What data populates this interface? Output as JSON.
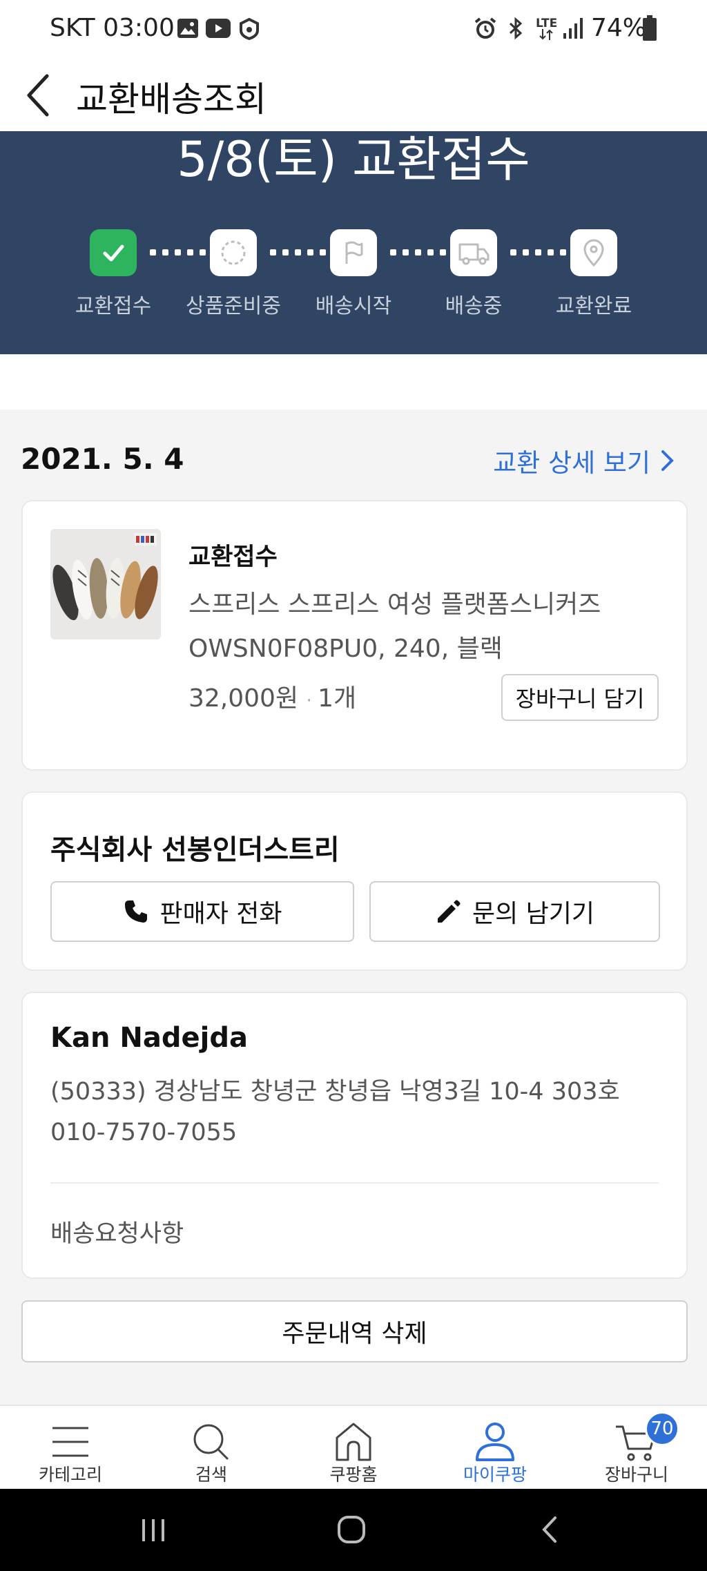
{
  "status_bar": {
    "carrier_time": "SKT 03:00",
    "battery": "74%",
    "lte": "LTE"
  },
  "header": {
    "title": "교환배송조회"
  },
  "hero": {
    "title": "5/8(토) 교환접수",
    "steps": [
      {
        "label": "교환접수",
        "icon": "check-icon",
        "done": true
      },
      {
        "label": "상품준비중",
        "icon": "loading-circle-icon",
        "done": false
      },
      {
        "label": "배송시작",
        "icon": "flag-icon",
        "done": false
      },
      {
        "label": "배송중",
        "icon": "truck-icon",
        "done": false
      },
      {
        "label": "교환완료",
        "icon": "location-pin-icon",
        "done": false
      }
    ]
  },
  "order": {
    "date": "2021. 5. 4",
    "detail_link": "교환 상세 보기",
    "status": "교환접수",
    "product_name": "스프리스 스프리스 여성 플랫폼스니커즈",
    "product_option": "OWSN0F08PU0, 240, 블랙",
    "price": "32,000원",
    "quantity": "1개",
    "cart_button": "장바구니 담기"
  },
  "seller": {
    "name": "주식회사 선봉인더스트리",
    "call_button": "판매자 전화",
    "inquiry_button": "문의 남기기"
  },
  "shipping": {
    "recipient": "Kan Nadejda",
    "address": "(50333) 경상남도 창녕군 창녕읍 낙영3길 10-4 303호",
    "phone": "010-7570-7055",
    "request_label": "배송요청사항"
  },
  "delete_button": "주문내역 삭제",
  "bottom_nav": {
    "items": [
      {
        "label": "카테고리",
        "icon": "menu-icon"
      },
      {
        "label": "검색",
        "icon": "search-icon"
      },
      {
        "label": "쿠팡홈",
        "icon": "home-icon"
      },
      {
        "label": "마이쿠팡",
        "icon": "user-icon",
        "active": true
      },
      {
        "label": "장바구니",
        "icon": "cart-icon"
      }
    ],
    "cart_badge": "70"
  },
  "colors": {
    "hero_bg": "#2f4563",
    "accent_blue": "#2e6fd8",
    "done_green": "#2eb35e"
  }
}
